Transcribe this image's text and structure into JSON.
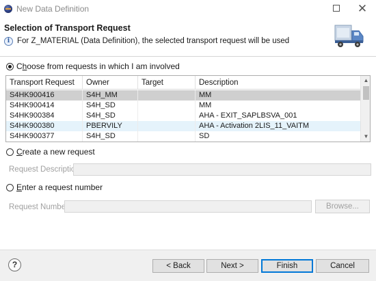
{
  "window": {
    "title": "New Data Definition",
    "maximize_icon": "maximize-icon",
    "close_glyph": "✕"
  },
  "header": {
    "title": "Selection of Transport Request",
    "message": "For Z_MATERIAL (Data Definition), the selected transport request will be used",
    "info_glyph": "i",
    "banner_icon": "truck-icon"
  },
  "options": {
    "choose_label_prefix": "C",
    "choose_label_access": "h",
    "choose_label_rest": "oose from requests in which I am involved",
    "create_label_access": "C",
    "create_label_rest": "reate a new request",
    "enter_label_access": "E",
    "enter_label_rest": "nter a request number",
    "selected": "choose"
  },
  "table": {
    "columns": [
      "Transport Request",
      "Owner",
      "Target",
      "Description"
    ],
    "rows": [
      {
        "request": "S4HK900416",
        "owner": "S4H_MM",
        "target": "",
        "description": "MM",
        "state": "selected"
      },
      {
        "request": "S4HK900414",
        "owner": "S4H_SD",
        "target": "",
        "description": "MM",
        "state": ""
      },
      {
        "request": "S4HK900384",
        "owner": "S4H_SD",
        "target": "",
        "description": "AHA - EXIT_SAPLBSVA_001",
        "state": ""
      },
      {
        "request": "S4HK900380",
        "owner": "PBERVILY",
        "target": "",
        "description": "AHA - Activation 2LIS_11_VAITM",
        "state": "hover"
      },
      {
        "request": "S4HK900377",
        "owner": "S4H_SD",
        "target": "",
        "description": "SD",
        "state": ""
      }
    ]
  },
  "fields": {
    "request_description_label": "Request Description:",
    "request_description_value": "",
    "request_number_label": "Request Number:",
    "request_number_value": "",
    "browse_label": "Browse..."
  },
  "footer": {
    "help_glyph": "?",
    "back_label": "< Back",
    "next_label": "Next >",
    "finish_label": "Finish",
    "cancel_label": "Cancel"
  },
  "colors": {
    "selected_row": "#cfcfcf",
    "hover_row": "#e5f3fb",
    "default_button_border": "#0078d7",
    "footer_bg": "#f0f0f0"
  }
}
